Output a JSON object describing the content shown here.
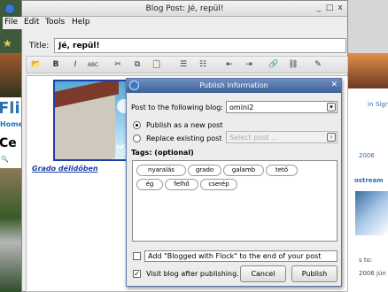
{
  "window": {
    "title": "Blog Post: Jé, repül!",
    "controls": [
      "_",
      "□",
      "x"
    ]
  },
  "menu": [
    "File",
    "Edit",
    "Tools",
    "Help"
  ],
  "post": {
    "title_label": "Title:",
    "title_value": "Jé, repül!",
    "caption": "Grado délidőben"
  },
  "toolbar_icons": [
    "open-icon",
    "bold-icon",
    "italic-icon",
    "spellcheck-icon",
    "cut-icon",
    "copy-icon",
    "paste-icon",
    "bulleted-list-icon",
    "numbered-list-icon",
    "outdent-icon",
    "indent-icon",
    "link-icon",
    "unlink-icon",
    "edit-icon"
  ],
  "toolbar_glyphs": [
    "📂",
    "B",
    "I",
    "ABC",
    "✂",
    "⧉",
    "📋",
    "☰",
    "☷",
    "⇤",
    "⇥",
    "🔗",
    "⛓",
    "✎"
  ],
  "dialog": {
    "title": "Publish Information",
    "post_to_label": "Post to the following blog:",
    "blog_value": "omini2",
    "publish_new": "Publish as a new post",
    "replace_existing": "Replace existing post",
    "select_post_placeholder": "Select post ...",
    "tags_label": "Tags: (optional)",
    "tags": [
      "nyaralás",
      "grado",
      "galamb",
      "tető",
      "ég",
      "felhő",
      "cserép"
    ],
    "add_blogged": "Add \"Blogged with Flock\" to the end of your post",
    "visit_blog": "Visit blog after publishing.",
    "cancel": "Cancel",
    "publish": "Publish"
  },
  "background": {
    "left_fli": "Fli",
    "left_home": "Home",
    "left_ce": "Ce",
    "right_links": [
      "in",
      "Sign",
      "2006",
      "ostream",
      "s to:",
      "2006 jún"
    ]
  }
}
